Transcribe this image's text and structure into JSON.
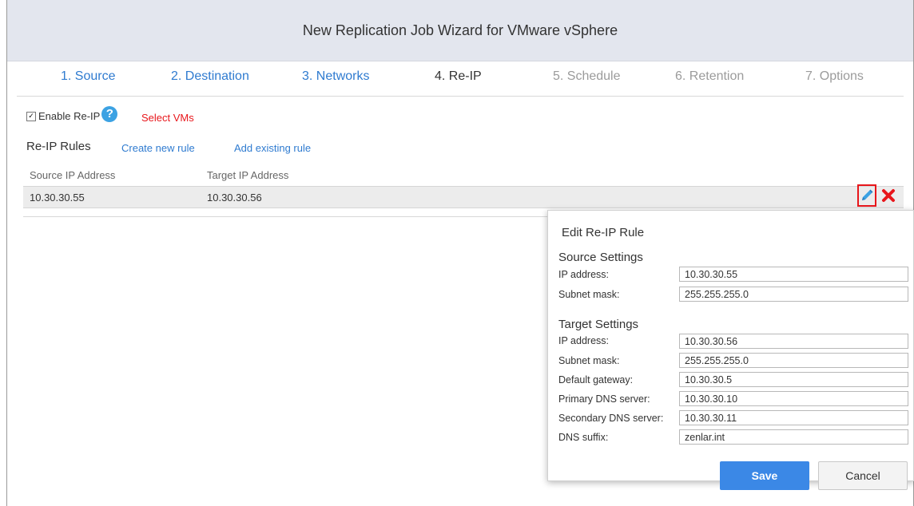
{
  "window": {
    "title": "New Replication Job Wizard for VMware vSphere"
  },
  "steps": [
    {
      "label": "1. Source",
      "state": "done"
    },
    {
      "label": "2. Destination",
      "state": "done"
    },
    {
      "label": "3. Networks",
      "state": "done"
    },
    {
      "label": "4. Re-IP",
      "state": "active"
    },
    {
      "label": "5. Schedule",
      "state": "disabled"
    },
    {
      "label": "6. Retention",
      "state": "disabled"
    },
    {
      "label": "7. Options",
      "state": "disabled"
    }
  ],
  "reip": {
    "enable_label": "Enable Re-IP",
    "enabled": true,
    "select_vms": "Select VMs",
    "rules_title": "Re-IP Rules",
    "create_rule": "Create new rule",
    "add_rule": "Add existing rule",
    "columns": [
      "Source IP Address",
      "Target IP Address"
    ],
    "rows": [
      {
        "source": "10.30.30.55",
        "target": "10.30.30.56"
      }
    ]
  },
  "icons": {
    "help": "question-circle-icon",
    "edit": "pencil-icon",
    "delete": "close-x-icon"
  },
  "colors": {
    "link": "#2f7bd0",
    "accent_red": "#e8161b",
    "primary_button": "#3b88e6",
    "header_bg": "#e3e6ee"
  },
  "edit_dialog": {
    "title": "Edit Re-IP Rule",
    "source_section": "Source Settings",
    "target_section": "Target Settings",
    "source_fields": [
      {
        "label": "IP address:",
        "value": "10.30.30.55"
      },
      {
        "label": "Subnet mask:",
        "value": "255.255.255.0"
      }
    ],
    "target_fields": [
      {
        "label": "IP address:",
        "value": "10.30.30.56"
      },
      {
        "label": "Subnet mask:",
        "value": "255.255.255.0"
      },
      {
        "label": "Default gateway:",
        "value": "10.30.30.5"
      },
      {
        "label": "Primary DNS server:",
        "value": "10.30.30.10"
      },
      {
        "label": "Secondary DNS server:",
        "value": "10.30.30.11"
      },
      {
        "label": "DNS suffix:",
        "value": "zenlar.int"
      }
    ],
    "save_label": "Save",
    "cancel_label": "Cancel"
  }
}
